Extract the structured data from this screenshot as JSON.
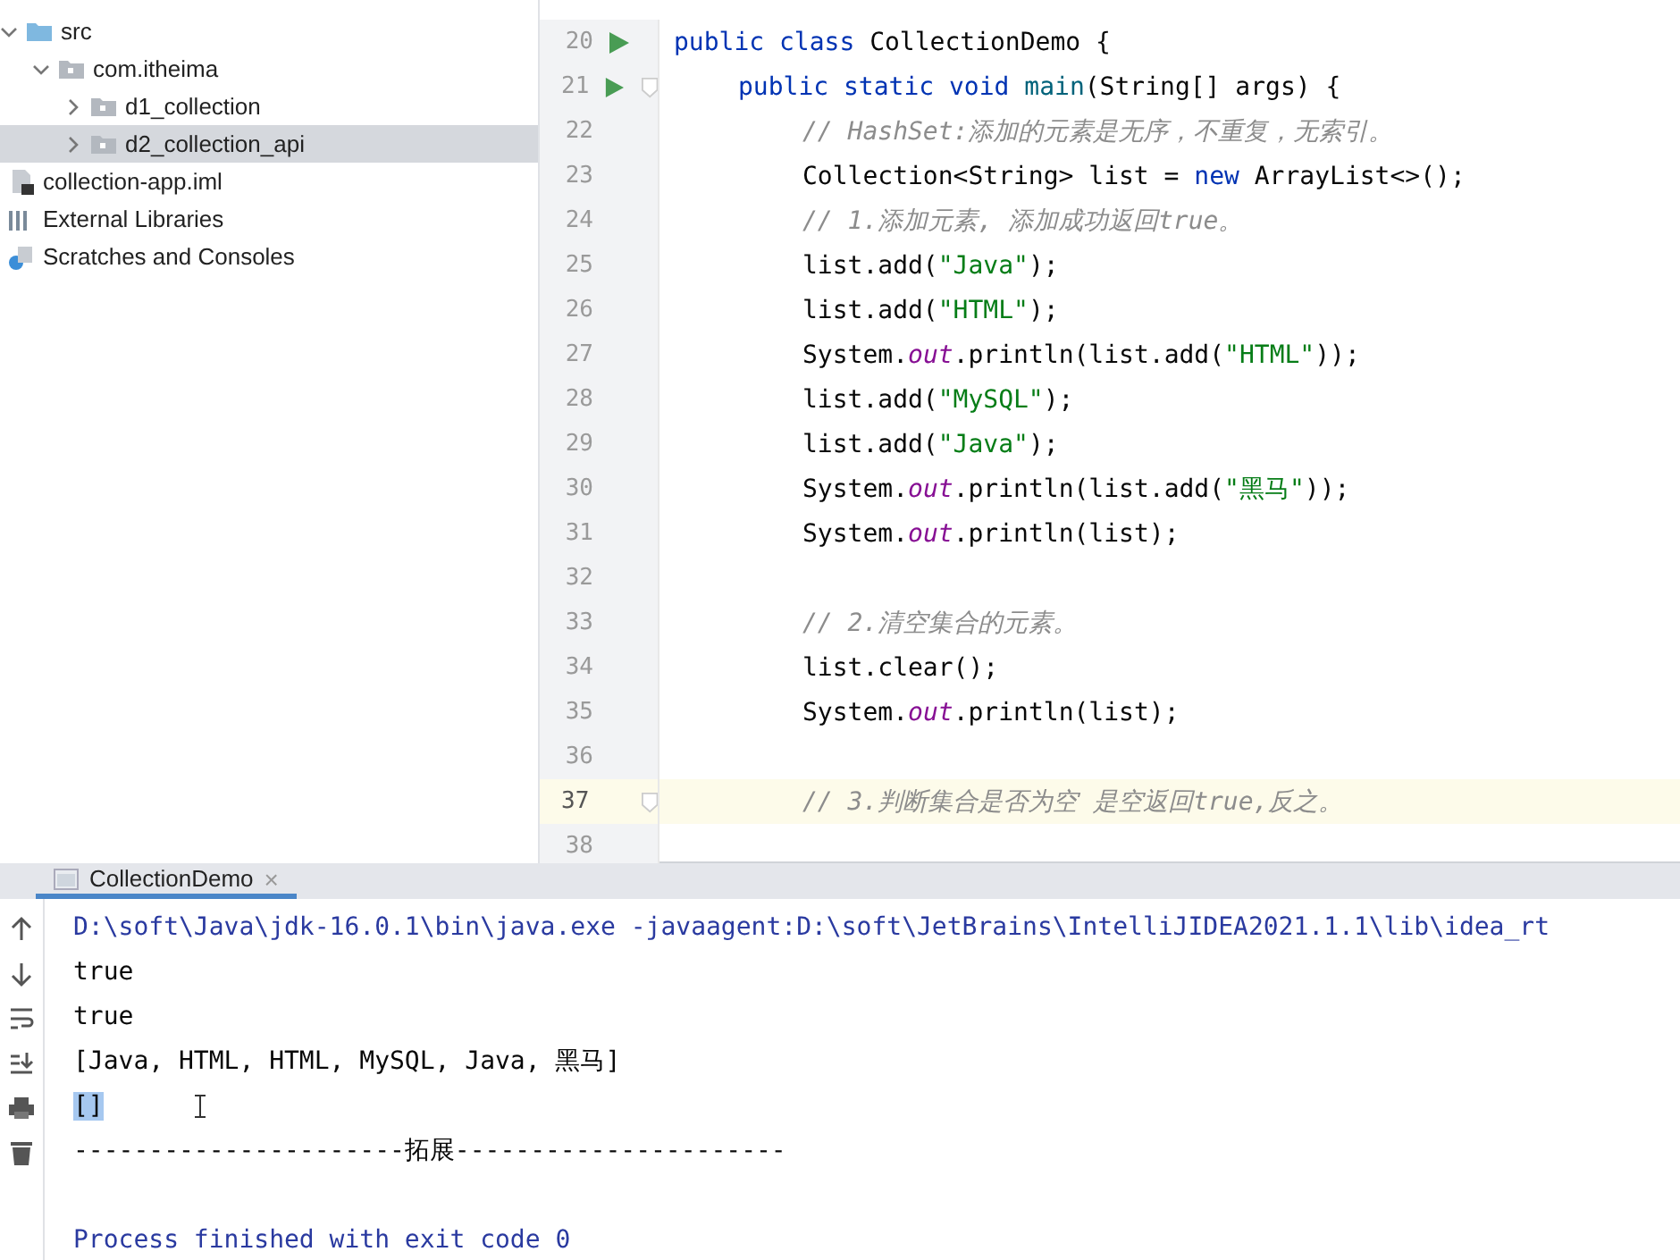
{
  "project_tree": [
    {
      "label": "src",
      "kind": "folder",
      "expanded": true,
      "selected": false,
      "children": [
        {
          "label": "com.itheima",
          "kind": "package",
          "expanded": true,
          "selected": false,
          "children": [
            {
              "label": "d1_collection",
              "kind": "package",
              "expanded": false,
              "selected": false
            },
            {
              "label": "d2_collection_api",
              "kind": "package",
              "expanded": false,
              "selected": true
            }
          ]
        }
      ]
    },
    {
      "label": "collection-app.iml",
      "kind": "module-file",
      "selected": false
    },
    {
      "label": "External Libraries",
      "kind": "library",
      "selected": false
    },
    {
      "label": "Scratches and Consoles",
      "kind": "scratches",
      "selected": false
    }
  ],
  "editor": {
    "lines": [
      {
        "number": "20",
        "run": true,
        "fold": false,
        "current": false,
        "tokens": [
          {
            "kind": "keyword",
            "text": "public class "
          },
          {
            "kind": "plain",
            "text": "CollectionDemo {"
          }
        ],
        "children": [
          {
            "number": "21",
            "run": true,
            "fold": true,
            "current": false,
            "tokens": [
              {
                "kind": "keyword",
                "text": "public static void "
              },
              {
                "kind": "method",
                "text": "main"
              },
              {
                "kind": "plain",
                "text": "(String[] args) {"
              }
            ],
            "children": [
              {
                "number": "22",
                "run": false,
                "fold": false,
                "current": false,
                "tokens": [
                  {
                    "kind": "comment",
                    "text": "// HashSet:添加的元素是无序，不重复，无索引。"
                  }
                ]
              },
              {
                "number": "23",
                "run": false,
                "fold": false,
                "current": false,
                "tokens": [
                  {
                    "kind": "plain",
                    "text": "Collection<String> list = "
                  },
                  {
                    "kind": "keyword",
                    "text": "new"
                  },
                  {
                    "kind": "plain",
                    "text": " ArrayList<>();"
                  }
                ]
              },
              {
                "number": "24",
                "run": false,
                "fold": false,
                "current": false,
                "tokens": [
                  {
                    "kind": "comment",
                    "text": "// 1.添加元素, 添加成功返回true。"
                  }
                ]
              },
              {
                "number": "25",
                "run": false,
                "fold": false,
                "current": false,
                "tokens": [
                  {
                    "kind": "plain",
                    "text": "list.add("
                  },
                  {
                    "kind": "string",
                    "text": "\"Java\""
                  },
                  {
                    "kind": "plain",
                    "text": ");"
                  }
                ]
              },
              {
                "number": "26",
                "run": false,
                "fold": false,
                "current": false,
                "tokens": [
                  {
                    "kind": "plain",
                    "text": "list.add("
                  },
                  {
                    "kind": "string",
                    "text": "\"HTML\""
                  },
                  {
                    "kind": "plain",
                    "text": ");"
                  }
                ]
              },
              {
                "number": "27",
                "run": false,
                "fold": false,
                "current": false,
                "tokens": [
                  {
                    "kind": "plain",
                    "text": "System."
                  },
                  {
                    "kind": "field",
                    "text": "out"
                  },
                  {
                    "kind": "plain",
                    "text": ".println(list.add("
                  },
                  {
                    "kind": "string",
                    "text": "\"HTML\""
                  },
                  {
                    "kind": "plain",
                    "text": "));"
                  }
                ]
              },
              {
                "number": "28",
                "run": false,
                "fold": false,
                "current": false,
                "tokens": [
                  {
                    "kind": "plain",
                    "text": "list.add("
                  },
                  {
                    "kind": "string",
                    "text": "\"MySQL\""
                  },
                  {
                    "kind": "plain",
                    "text": ");"
                  }
                ]
              },
              {
                "number": "29",
                "run": false,
                "fold": false,
                "current": false,
                "tokens": [
                  {
                    "kind": "plain",
                    "text": "list.add("
                  },
                  {
                    "kind": "string",
                    "text": "\"Java\""
                  },
                  {
                    "kind": "plain",
                    "text": ");"
                  }
                ]
              },
              {
                "number": "30",
                "run": false,
                "fold": false,
                "current": false,
                "tokens": [
                  {
                    "kind": "plain",
                    "text": "System."
                  },
                  {
                    "kind": "field",
                    "text": "out"
                  },
                  {
                    "kind": "plain",
                    "text": ".println(list.add("
                  },
                  {
                    "kind": "string",
                    "text": "\"黑马\""
                  },
                  {
                    "kind": "plain",
                    "text": "));"
                  }
                ]
              },
              {
                "number": "31",
                "run": false,
                "fold": false,
                "current": false,
                "tokens": [
                  {
                    "kind": "plain",
                    "text": "System."
                  },
                  {
                    "kind": "field",
                    "text": "out"
                  },
                  {
                    "kind": "plain",
                    "text": ".println(list);"
                  }
                ]
              },
              {
                "number": "32",
                "run": false,
                "fold": false,
                "current": false
              },
              {
                "number": "33",
                "run": false,
                "fold": false,
                "current": false,
                "tokens": [
                  {
                    "kind": "comment",
                    "text": "// 2.清空集合的元素。"
                  }
                ]
              },
              {
                "number": "34",
                "run": false,
                "fold": false,
                "current": false,
                "tokens": [
                  {
                    "kind": "plain",
                    "text": "list.clear();"
                  }
                ]
              },
              {
                "number": "35",
                "run": false,
                "fold": false,
                "current": false,
                "tokens": [
                  {
                    "kind": "plain",
                    "text": "System."
                  },
                  {
                    "kind": "field",
                    "text": "out"
                  },
                  {
                    "kind": "plain",
                    "text": ".println(list);"
                  }
                ]
              },
              {
                "number": "36",
                "run": false,
                "fold": false,
                "current": false
              },
              {
                "number": "37",
                "run": false,
                "fold": true,
                "current": true,
                "tokens": [
                  {
                    "kind": "comment",
                    "text": "// 3.判断集合是否为空 是空返回true,反之。"
                  }
                ]
              },
              {
                "number": "38",
                "run": false,
                "fold": false,
                "current": false
              }
            ]
          }
        ]
      }
    ]
  },
  "run_panel": {
    "tabs": [
      {
        "label": "CollectionDemo",
        "close": "×",
        "selected": true
      }
    ],
    "console": [
      {
        "kind": "command",
        "text": "D:\\soft\\Java\\jdk-16.0.1\\bin\\java.exe -javaagent:D:\\soft\\JetBrains\\IntelliJIDEA2021.1.1\\lib\\idea_rt",
        "selected": false
      },
      {
        "kind": "output",
        "text": "true",
        "selected": false
      },
      {
        "kind": "output",
        "text": "true",
        "selected": false
      },
      {
        "kind": "output",
        "text": "[Java, HTML, HTML, MySQL, Java, 黑马]",
        "selected": false
      },
      {
        "kind": "output",
        "text": "[]",
        "selected": true
      },
      {
        "kind": "output",
        "text": "----------------------拓展----------------------",
        "selected": false
      },
      {
        "kind": "blank"
      },
      {
        "kind": "command",
        "text": "Process finished with exit code 0",
        "selected": false
      }
    ]
  }
}
